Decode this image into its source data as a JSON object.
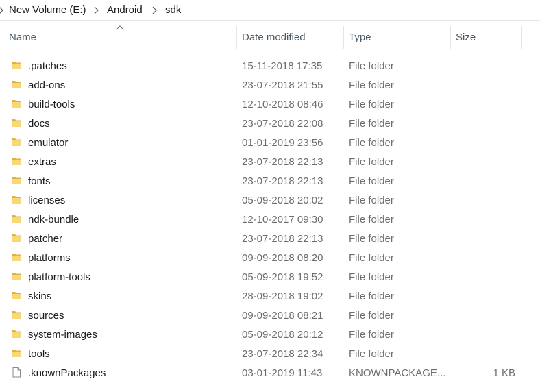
{
  "breadcrumb": {
    "items": [
      "New Volume (E:)",
      "Android",
      "sdk"
    ]
  },
  "columns": {
    "name": "Name",
    "date": "Date modified",
    "type": "Type",
    "size": "Size"
  },
  "files": [
    {
      "name": ".patches",
      "date": "15-11-2018 17:35",
      "type": "File folder",
      "size": "",
      "icon": "folder-icon"
    },
    {
      "name": "add-ons",
      "date": "23-07-2018 21:55",
      "type": "File folder",
      "size": "",
      "icon": "folder-icon"
    },
    {
      "name": "build-tools",
      "date": "12-10-2018 08:46",
      "type": "File folder",
      "size": "",
      "icon": "folder-icon"
    },
    {
      "name": "docs",
      "date": "23-07-2018 22:08",
      "type": "File folder",
      "size": "",
      "icon": "folder-icon"
    },
    {
      "name": "emulator",
      "date": "01-01-2019 23:56",
      "type": "File folder",
      "size": "",
      "icon": "folder-icon"
    },
    {
      "name": "extras",
      "date": "23-07-2018 22:13",
      "type": "File folder",
      "size": "",
      "icon": "folder-icon"
    },
    {
      "name": "fonts",
      "date": "23-07-2018 22:13",
      "type": "File folder",
      "size": "",
      "icon": "folder-icon"
    },
    {
      "name": "licenses",
      "date": "05-09-2018 20:02",
      "type": "File folder",
      "size": "",
      "icon": "folder-icon"
    },
    {
      "name": "ndk-bundle",
      "date": "12-10-2017 09:30",
      "type": "File folder",
      "size": "",
      "icon": "folder-icon"
    },
    {
      "name": "patcher",
      "date": "23-07-2018 22:13",
      "type": "File folder",
      "size": "",
      "icon": "folder-icon"
    },
    {
      "name": "platforms",
      "date": "09-09-2018 08:20",
      "type": "File folder",
      "size": "",
      "icon": "folder-icon"
    },
    {
      "name": "platform-tools",
      "date": "05-09-2018 19:52",
      "type": "File folder",
      "size": "",
      "icon": "folder-icon"
    },
    {
      "name": "skins",
      "date": "28-09-2018 19:02",
      "type": "File folder",
      "size": "",
      "icon": "folder-icon"
    },
    {
      "name": "sources",
      "date": "09-09-2018 08:21",
      "type": "File folder",
      "size": "",
      "icon": "folder-icon"
    },
    {
      "name": "system-images",
      "date": "05-09-2018 20:12",
      "type": "File folder",
      "size": "",
      "icon": "folder-icon"
    },
    {
      "name": "tools",
      "date": "23-07-2018 22:34",
      "type": "File folder",
      "size": "",
      "icon": "folder-icon"
    },
    {
      "name": ".knownPackages",
      "date": "03-01-2019 11:43",
      "type": "KNOWNPACKAGE...",
      "size": "1 KB",
      "icon": "file-icon"
    }
  ],
  "colors": {
    "folder": "#f8d775",
    "folder_dark": "#e0b13f",
    "header_text": "#4a5a6a",
    "muted_text": "#6d6d6d"
  }
}
